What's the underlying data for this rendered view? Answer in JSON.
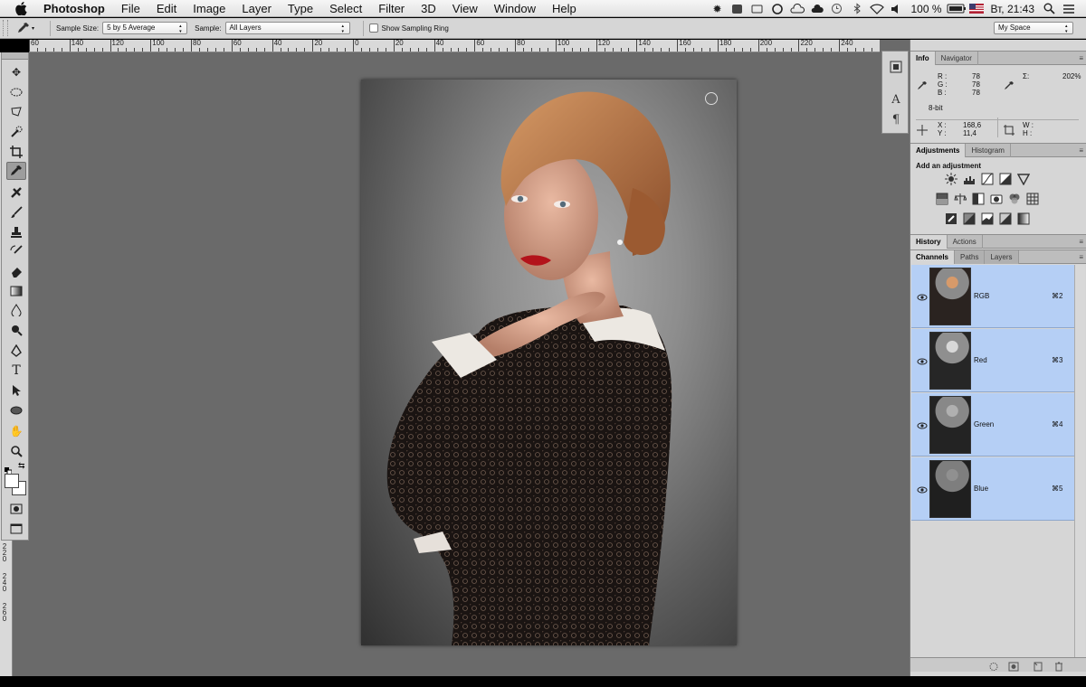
{
  "menubar": {
    "app_name": "Photoshop",
    "items": [
      "File",
      "Edit",
      "Image",
      "Layer",
      "Type",
      "Select",
      "Filter",
      "3D",
      "View",
      "Window",
      "Help"
    ],
    "battery": "100 %",
    "clock": "Вт, 21:43"
  },
  "options": {
    "sample_size_label": "Sample Size:",
    "sample_size_value": "5 by 5 Average",
    "sample_label": "Sample:",
    "sample_value": "All Layers",
    "show_ring_label": "Show Sampling Ring",
    "workspace": "My Space"
  },
  "rulers": {
    "top": [
      "60",
      "140",
      "120",
      "100",
      "80",
      "60",
      "40",
      "20",
      "0",
      "20",
      "40",
      "60",
      "80",
      "100",
      "120",
      "140",
      "160",
      "180",
      "200",
      "220",
      "240"
    ],
    "left": [
      "2",
      "2",
      "0",
      "2",
      "4",
      "0",
      "2",
      "6",
      "0"
    ]
  },
  "info_panel": {
    "tabs": [
      "Info",
      "Navigator"
    ],
    "r_label": "R :",
    "r": "78",
    "g_label": "G :",
    "g": "78",
    "b_label": "B :",
    "b": "78",
    "bit_depth": "8-bit",
    "sigma_label": "Σ:",
    "sigma": "202%",
    "x_label": "X :",
    "x": "168,6",
    "y_label": "Y :",
    "y": "11,4",
    "w_label": "W :",
    "h_label": "H :"
  },
  "adjustments_panel": {
    "tabs": [
      "Adjustments",
      "Histogram"
    ],
    "heading": "Add an adjustment"
  },
  "history_panel": {
    "tabs": [
      "History",
      "Actions"
    ]
  },
  "channels_panel": {
    "tabs": [
      "Channels",
      "Paths",
      "Layers"
    ],
    "channels": [
      {
        "name": "RGB",
        "shortcut": "⌘2"
      },
      {
        "name": "Red",
        "shortcut": "⌘3"
      },
      {
        "name": "Green",
        "shortcut": "⌘4"
      },
      {
        "name": "Blue",
        "shortcut": "⌘5"
      }
    ]
  },
  "colors": {
    "selection": "#b5cff5",
    "canvas_bg": "#6a6a6a",
    "panel_bg": "#d6d6d6"
  }
}
